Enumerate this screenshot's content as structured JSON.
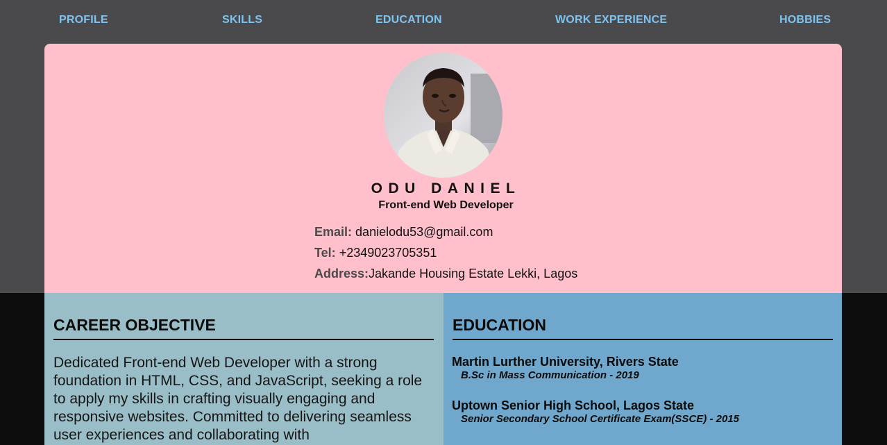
{
  "nav": {
    "items": [
      {
        "label": "PROFILE"
      },
      {
        "label": "SKILLS"
      },
      {
        "label": "EDUCATION"
      },
      {
        "label": "WORK EXPERIENCE"
      },
      {
        "label": "HOBBIES"
      }
    ],
    "color": "#7ec4f0"
  },
  "profile": {
    "name": "ODU DANIEL",
    "role": "Front-end Web Developer",
    "email_label": "Email:",
    "email": "danielodu53@gmail.com",
    "tel_label": "Tel:",
    "tel": "+2349023705351",
    "address_label": "Address:",
    "address": "Jakande Housing Estate Lekki, Lagos",
    "card_color": "#ffc0cb"
  },
  "career": {
    "title": "CAREER OBJECTIVE",
    "text": "Dedicated Front-end Web Developer with a strong foundation in HTML, CSS, and JavaScript, seeking a role to apply my skills in crafting visually engaging and responsive websites. Committed to delivering seamless user experiences and collaborating with",
    "bg_color": "#9abec8"
  },
  "education": {
    "title": "EDUCATION",
    "items": [
      {
        "school": "Martin Lurther University, Rivers State",
        "detail": "B.Sc in Mass Communication - 2019"
      },
      {
        "school": "Uptown Senior High School, Lagos State",
        "detail": "Senior Secondary School Certificate Exam(SSCE) - 2015"
      }
    ],
    "bg_color": "#6fa8cc"
  }
}
